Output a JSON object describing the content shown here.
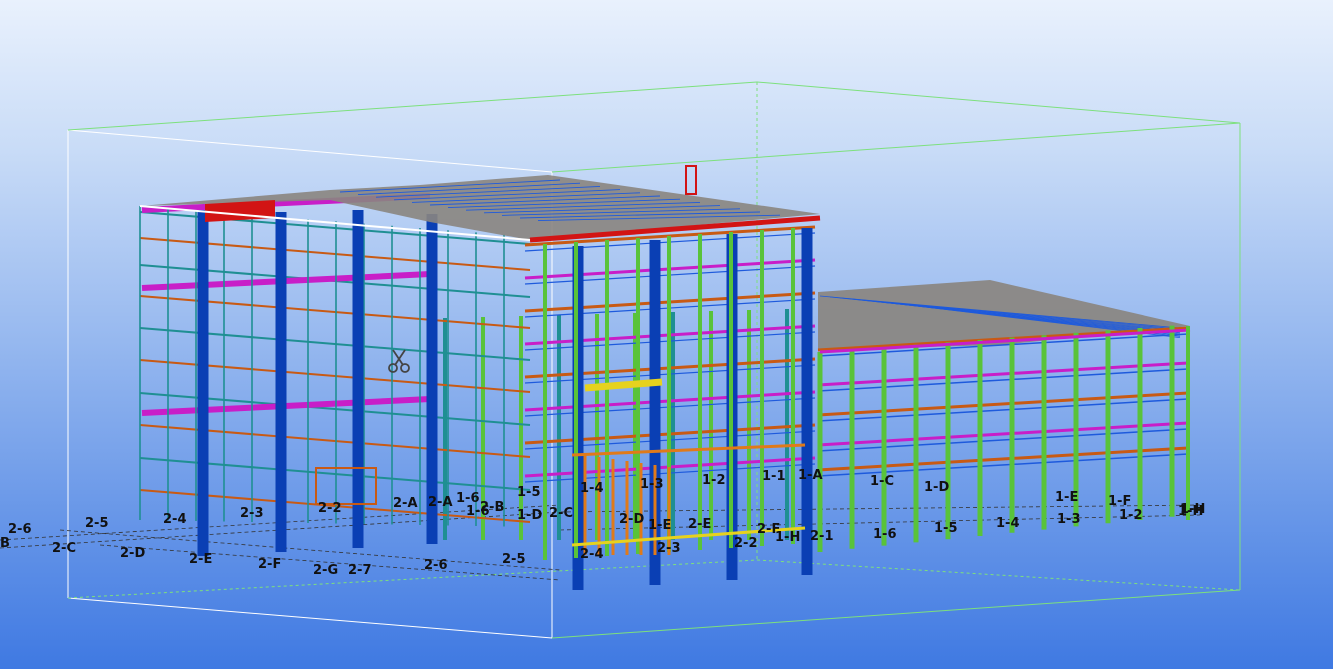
{
  "viewport": {
    "background_top": "#e9f1fd",
    "background_bottom": "#3f79e2"
  },
  "colors": {
    "work_area_box": "#ffffff",
    "work_area_box_far": "#7de07d",
    "column_blue": "#0a3fb4",
    "column_teal": "#1f8f93",
    "column_green": "#59c33a",
    "beam_magenta": "#c81ec8",
    "beam_orange": "#c85a14",
    "beam_blue": "#1e5adc",
    "roof_grey": "#8a8580",
    "roof_red": "#d21414",
    "highlight_yellow": "#e6d21e",
    "stair_orange": "#e07a1a"
  },
  "icons": [
    "cut-plane-scissors-icon"
  ],
  "grid_labels": [
    "2-6",
    "2-5",
    "2-4",
    "2-3",
    "2-2",
    "2-A",
    "2-A",
    "1-6",
    "2-B",
    "1-5",
    "1-4",
    "1-3",
    "1-2",
    "1-1",
    "1-A",
    "1-C",
    "1-D",
    "1-E",
    "1-F",
    "1-H",
    "B",
    "2-C",
    "2-D",
    "2-E",
    "2-F",
    "2-G",
    "2-7",
    "2-6",
    "2-5",
    "1-6",
    "1-D",
    "2-C",
    "2-D",
    "1-E",
    "2-E",
    "2-F",
    "1-H",
    "2-4",
    "2-3",
    "2-2",
    "2-1",
    "1-6",
    "1-5",
    "1-4",
    "1-3",
    "1-2",
    "1-H"
  ]
}
